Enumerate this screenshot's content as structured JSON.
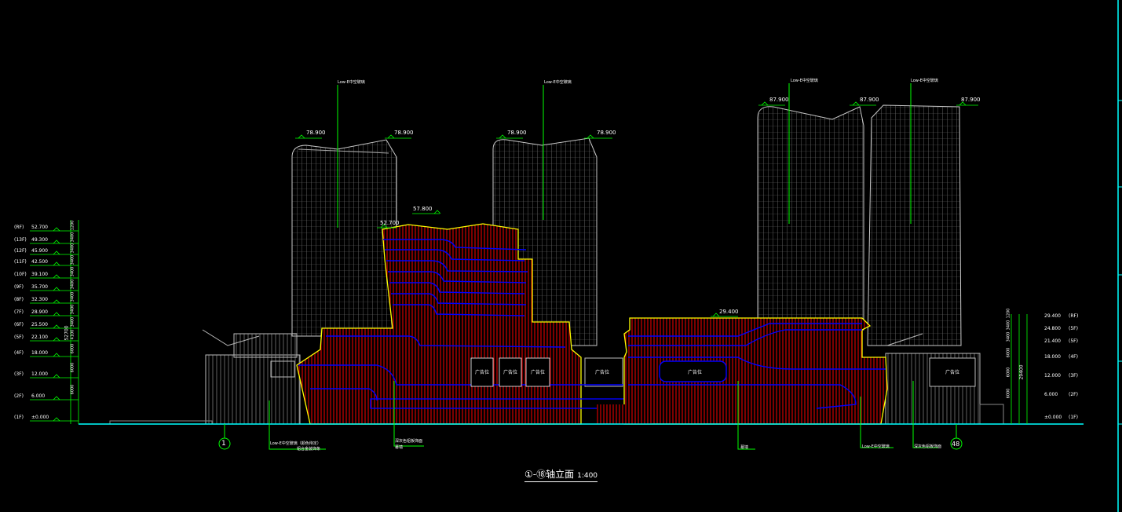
{
  "drawing": {
    "title": "①-⑱轴立面",
    "scale": "1:400",
    "axis_start": "1",
    "axis_end": "48"
  },
  "left_levels": [
    {
      "floor": "(RF)",
      "elev": "52.700"
    },
    {
      "floor": "(13F)",
      "elev": "49.300"
    },
    {
      "floor": "(12F)",
      "elev": "45.900"
    },
    {
      "floor": "(11F)",
      "elev": "42.500"
    },
    {
      "floor": "(10F)",
      "elev": "39.100"
    },
    {
      "floor": "(9F)",
      "elev": "35.700"
    },
    {
      "floor": "(8F)",
      "elev": "32.300"
    },
    {
      "floor": "(7F)",
      "elev": "28.900"
    },
    {
      "floor": "(6F)",
      "elev": "25.500"
    },
    {
      "floor": "(5F)",
      "elev": "22.100"
    },
    {
      "floor": "(4F)",
      "elev": "18.000"
    },
    {
      "floor": "(3F)",
      "elev": "12.000"
    },
    {
      "floor": "(2F)",
      "elev": "6.000"
    },
    {
      "floor": "(1F)",
      "elev": "±0.000"
    }
  ],
  "right_levels": [
    {
      "floor": "(RF)",
      "elev": "29.400"
    },
    {
      "floor": "(5F)",
      "elev": "24.800"
    },
    {
      "floor": "(5F)",
      "elev": "21.400"
    },
    {
      "floor": "(4F)",
      "elev": "18.000"
    },
    {
      "floor": "(3F)",
      "elev": "12.000"
    },
    {
      "floor": "(2F)",
      "elev": "6.000"
    },
    {
      "floor": "(1F)",
      "elev": "±0.000"
    }
  ],
  "left_dims": [
    "1200",
    "3400",
    "3400",
    "3400",
    "3400",
    "3400",
    "3400",
    "3400",
    "3400",
    "4100",
    "6000",
    "6000",
    "6000"
  ],
  "left_total": "52700",
  "right_dims": [
    "1200",
    "3400",
    "3400",
    "6000",
    "6000",
    "6000"
  ],
  "right_total": "29400",
  "tower_elevs": {
    "t1_left": "78.900",
    "t1_right": "78.900",
    "t2_left": "78.900",
    "t2_right": "78.900",
    "t3_left": "87.900",
    "t3_right": "87.900",
    "t4_right": "87.900",
    "podium_top": "57.800",
    "podium_ledge": "52.700",
    "east_roof": "29.400"
  },
  "ad_label": "广告位",
  "callouts": [
    {
      "id": "c1",
      "text": "Low-E中空玻璃"
    },
    {
      "id": "c2",
      "text": "Low-E中空玻璃"
    },
    {
      "id": "c3",
      "text": "Low-E中空玻璃"
    },
    {
      "id": "c4",
      "text": "Low-E中空玻璃"
    },
    {
      "id": "c5a",
      "text": "Low-E中空玻璃（颜色待定）"
    },
    {
      "id": "c5b",
      "text": "铝合金装饰条"
    },
    {
      "id": "c6a",
      "text": "深灰色铝板饰面"
    },
    {
      "id": "c6b",
      "text": "幕墙"
    },
    {
      "id": "c7",
      "text": "幕墙"
    },
    {
      "id": "c8",
      "text": "Low-E中空玻璃"
    },
    {
      "id": "c9",
      "text": "深灰色铝板饰面"
    }
  ],
  "colors": {
    "background": "#000000",
    "outline": "#c0c0c0",
    "callout": "#00ff00",
    "level": "#00ff00",
    "podium_fill": "#cc0000",
    "podium_edge": "#ffff00",
    "band": "#0000ff",
    "ground": "#00ffff"
  }
}
